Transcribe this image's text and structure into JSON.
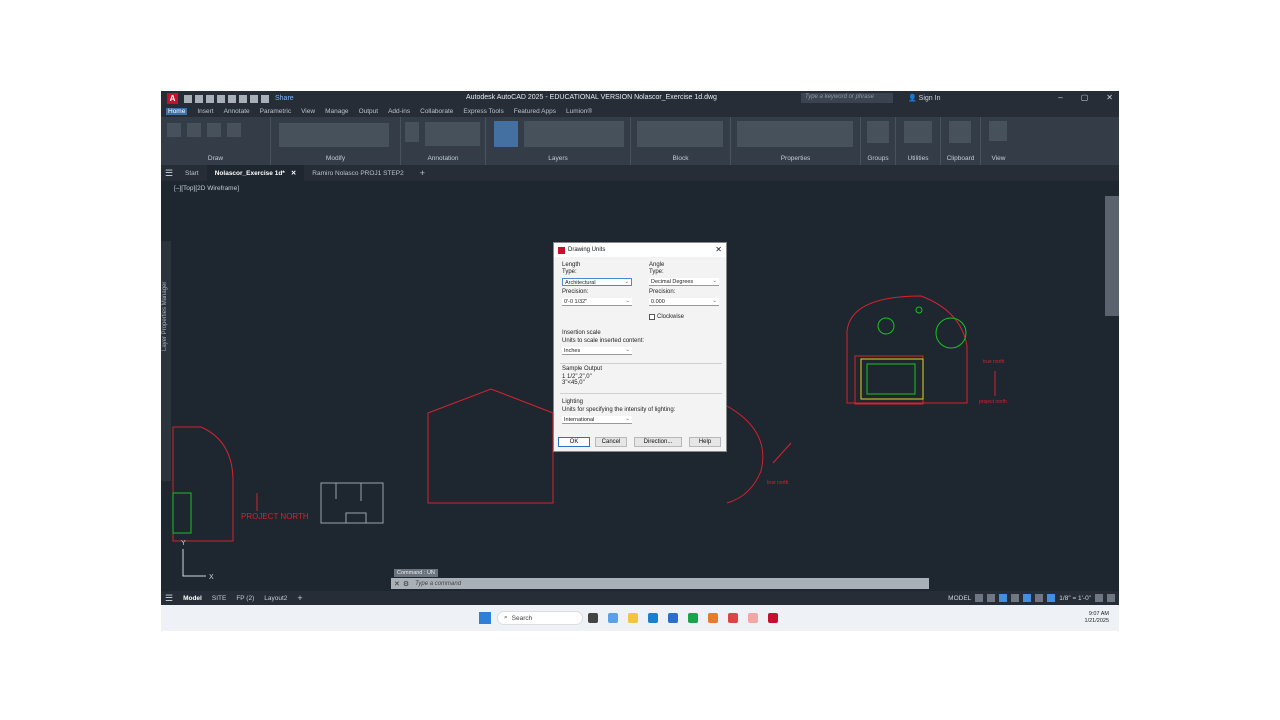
{
  "titlebar": {
    "app_icon_letter": "A",
    "share_label": "Share",
    "title": "Autodesk AutoCAD 2025 - EDUCATIONAL VERSION   Nolascor_Exercise 1d.dwg",
    "search_placeholder": "Type a keyword or phrase",
    "signin_label": "Sign In"
  },
  "menu_tabs": [
    "Home",
    "Insert",
    "Annotate",
    "Parametric",
    "View",
    "Manage",
    "Output",
    "Add-ins",
    "Collaborate",
    "Express Tools",
    "Featured Apps",
    "Lumion®"
  ],
  "ribbon_panels": [
    "Draw",
    "Modify",
    "Annotation",
    "Layers",
    "Block",
    "Properties",
    "Groups",
    "Utilities",
    "Clipboard",
    "View"
  ],
  "doc_tabs": [
    "Start",
    "Nolascor_Exercise 1d*",
    "Ramiro Nolasco PROJ1 STEP2"
  ],
  "viewport_label": "[–][Top][2D Wireframe]",
  "side_palette_label": "Layer Properties Manager",
  "drawing": {
    "project_north": "PROJECT  NORTH",
    "true_north": "true north",
    "project_north_small": "project north"
  },
  "dialog": {
    "title": "Drawing Units",
    "length_header": "Length",
    "length_type_label": "Type:",
    "length_type_value": "Architectural",
    "length_precision_label": "Precision:",
    "length_precision_value": "0'-0 1/32\"",
    "angle_header": "Angle",
    "angle_type_label": "Type:",
    "angle_type_value": "Decimal Degrees",
    "angle_precision_label": "Precision:",
    "angle_precision_value": "0.000",
    "clockwise_label": "Clockwise",
    "insertion_header": "Insertion scale",
    "insertion_sub": "Units to scale inserted content:",
    "insertion_value": "Inches",
    "sample_header": "Sample Output",
    "sample_line1": "1 1/2\",2\",0\"",
    "sample_line2": "3\"<45,0\"",
    "lighting_header": "Lighting",
    "lighting_sub": "Units for specifying the intensity of lighting:",
    "lighting_value": "International",
    "ok_label": "OK",
    "cancel_label": "Cancel",
    "direction_label": "Direction...",
    "help_label": "Help"
  },
  "command": {
    "history": "Command : UN",
    "placeholder": "Type a command"
  },
  "layout_tabs": [
    "Model",
    "SITE",
    "FP (2)",
    "Layout2"
  ],
  "status": {
    "model_label": "MODEL",
    "scale_label": "1/8\" = 1'-0\""
  },
  "taskbar": {
    "search_label": "Search",
    "time": "9:07 AM",
    "date": "1/21/2025"
  },
  "colors": {
    "accent": "#3d6fa7",
    "drawing_red": "#d4242c",
    "drawing_green": "#19c21f",
    "background": "#1e2630"
  }
}
